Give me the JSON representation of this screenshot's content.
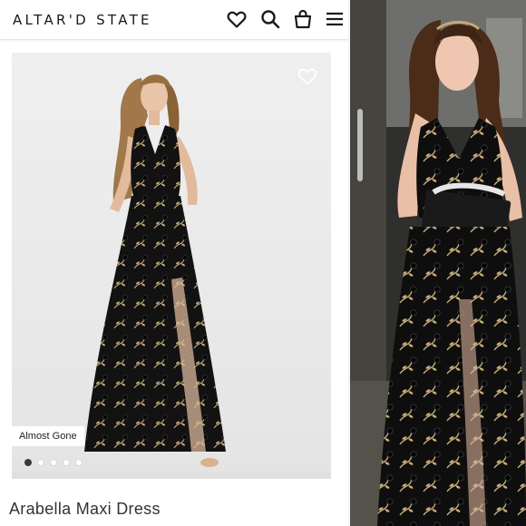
{
  "header": {
    "logo": "ALTAR'D STATE",
    "icons": [
      "heart-icon",
      "search-icon",
      "shopping-bag-icon",
      "menu-icon"
    ]
  },
  "product": {
    "badge": "Almost Gone",
    "name": "Arabella Maxi Dress",
    "image_count": 5,
    "active_image": 1
  },
  "colors": {
    "accent": "#1a1a1a",
    "image_bg": "#ececec",
    "dress": "#111111",
    "embroidery": "#c9ad7a"
  }
}
